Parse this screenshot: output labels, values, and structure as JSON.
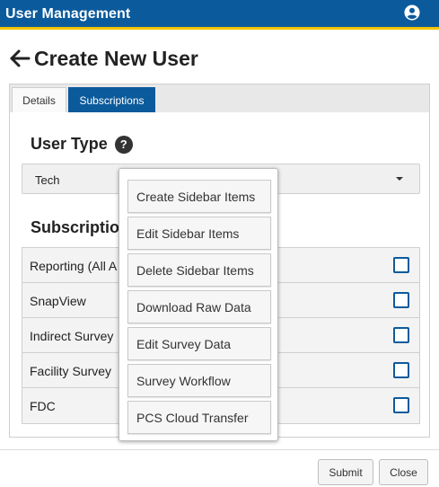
{
  "header": {
    "title": "User Management",
    "user_icon": "account-circle-icon"
  },
  "page": {
    "title": "Create New User",
    "back_icon": "arrow-left-icon"
  },
  "tabs": [
    {
      "label": "Details",
      "active": false
    },
    {
      "label": "Subscriptions",
      "active": true
    }
  ],
  "user_type": {
    "heading": "User Type",
    "help_icon": "?",
    "selected": "Tech"
  },
  "subscriptions": {
    "heading": "Subscriptio",
    "rows": [
      {
        "label": "Reporting (All A",
        "checked": false
      },
      {
        "label": "SnapView",
        "checked": false
      },
      {
        "label": "Indirect Survey",
        "checked": false
      },
      {
        "label": "Facility Survey",
        "checked": false
      },
      {
        "label": "FDC",
        "checked": false
      }
    ]
  },
  "dropdown": {
    "items": [
      "Create Sidebar Items",
      "Edit Sidebar Items",
      "Delete Sidebar Items",
      "Download Raw Data",
      "Edit Survey Data",
      "Survey Workflow",
      "PCS Cloud Transfer"
    ]
  },
  "footer": {
    "submit_label": "Submit",
    "close_label": "Close"
  },
  "colors": {
    "brand_blue": "#0b5a9c",
    "accent_yellow": "#f5c400",
    "checkbox_border": "#0b5a9c"
  }
}
